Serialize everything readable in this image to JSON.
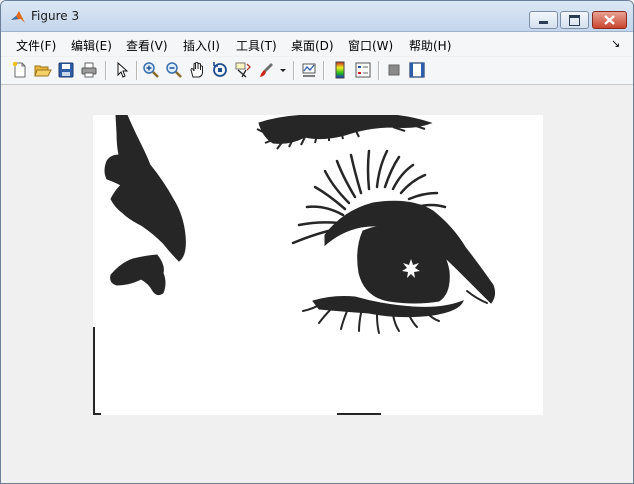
{
  "window": {
    "title": "Figure 3"
  },
  "menu": {
    "items": [
      {
        "label": "文件(F)"
      },
      {
        "label": "编辑(E)"
      },
      {
        "label": "查看(V)"
      },
      {
        "label": "插入(I)"
      },
      {
        "label": "工具(T)"
      },
      {
        "label": "桌面(D)"
      },
      {
        "label": "窗口(W)"
      },
      {
        "label": "帮助(H)"
      }
    ],
    "overflow_glyph": "↘"
  },
  "toolbar": {
    "icons": [
      "new-figure-icon",
      "open-file-icon",
      "save-icon",
      "print-icon",
      "edit-plot-arrow-icon",
      "zoom-in-icon",
      "zoom-out-icon",
      "pan-hand-icon",
      "rotate-3d-icon",
      "data-cursor-icon",
      "brush-icon",
      "brush-dropdown-icon",
      "link-plot-icon",
      "insert-colorbar-icon",
      "insert-legend-icon",
      "hide-plot-tools-icon",
      "show-plot-tools-icon"
    ]
  },
  "figure": {
    "content": "binary image of a woman's eye with eyelashes and eyebrow",
    "colors": {
      "ink": "#262626",
      "paper": "#ffffff"
    }
  },
  "colors": {
    "titlebar_top": "#dbe7f5",
    "titlebar_bottom": "#c4d6ec",
    "close_button": "#c9452e",
    "background": "#f0f0f0"
  }
}
